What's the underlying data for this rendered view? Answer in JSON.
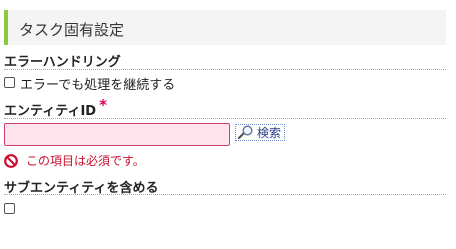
{
  "section": {
    "title": "タスク固有設定"
  },
  "error_handling": {
    "label": "エラーハンドリング",
    "checkbox_label": "エラーでも処理を継続する",
    "checked": false
  },
  "entity_id": {
    "label": "エンティティID",
    "required_mark": "*",
    "value": "",
    "search_label": "検索",
    "error_message": "この項目は必須です。"
  },
  "include_sub_entities": {
    "label": "サブエンティティを含める",
    "checked": false
  },
  "colors": {
    "accent": "#8dc63f",
    "error": "#c8102e",
    "input_error_bg": "#ffe4ee"
  },
  "icons": {
    "search": "magnifier-icon",
    "error": "prohibited-icon"
  }
}
